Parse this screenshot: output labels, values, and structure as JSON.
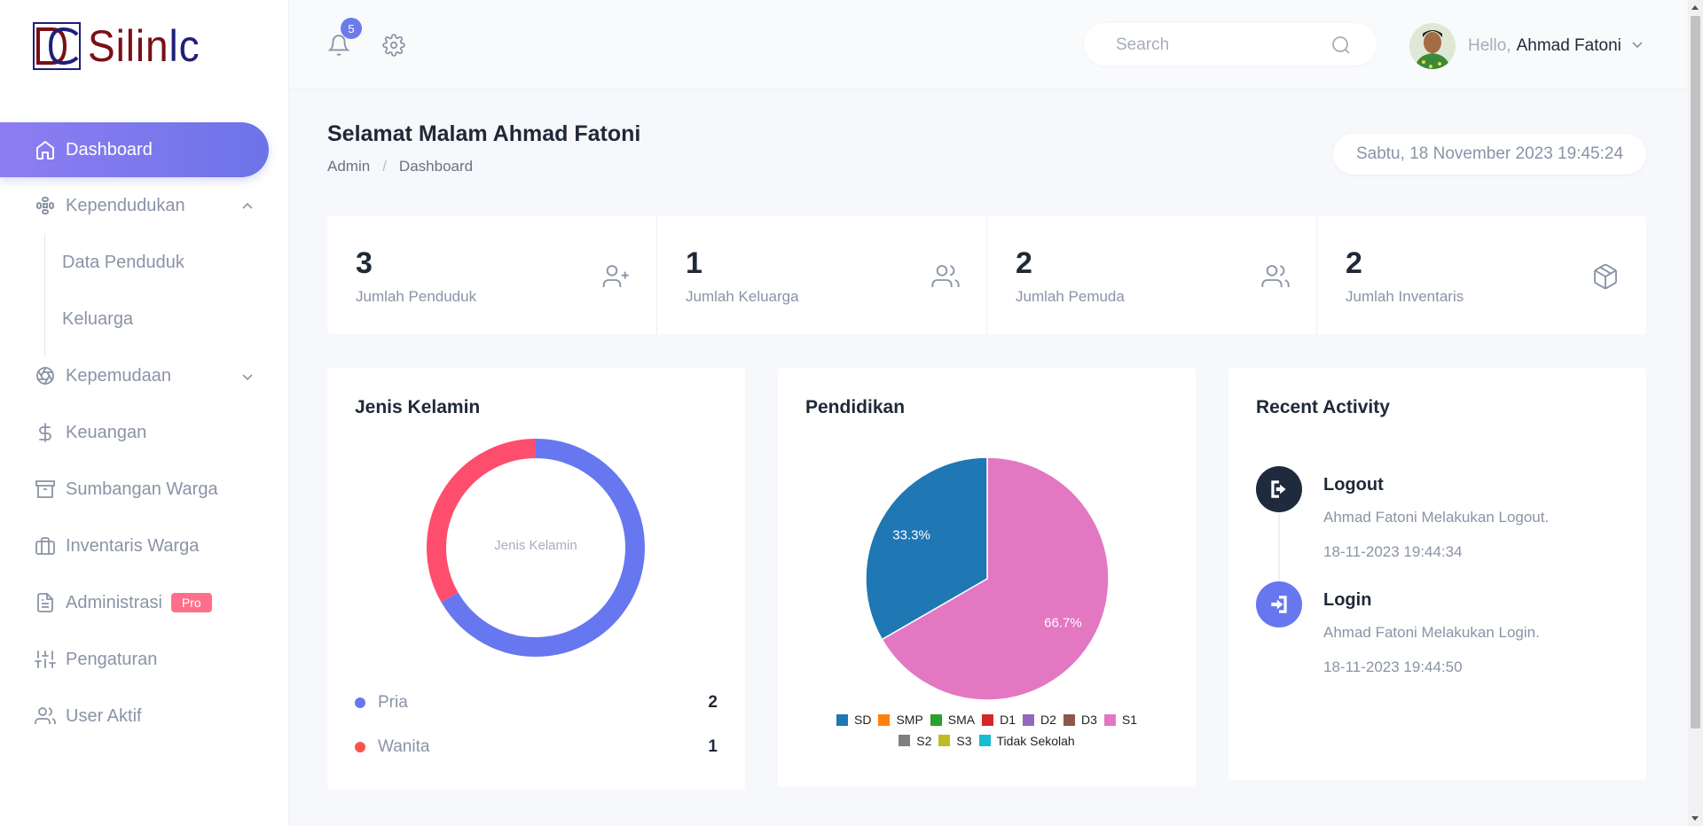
{
  "brand": {
    "logo_text_a": "Silin",
    "logo_text_b": "lc",
    "logo_mark_letters": "DC"
  },
  "sidebar": {
    "items": [
      {
        "label": "Dashboard",
        "icon": "home-icon",
        "active": true
      },
      {
        "label": "Kependudukan",
        "icon": "grid-icon",
        "expanded": true,
        "children": [
          {
            "label": "Data Penduduk"
          },
          {
            "label": "Keluarga"
          }
        ]
      },
      {
        "label": "Kepemudaan",
        "icon": "aperture-icon",
        "expanded": false
      },
      {
        "label": "Keuangan",
        "icon": "dollar-icon"
      },
      {
        "label": "Sumbangan Warga",
        "icon": "archive-icon"
      },
      {
        "label": "Inventaris Warga",
        "icon": "briefcase-icon"
      },
      {
        "label": "Administrasi",
        "icon": "file-text-icon",
        "badge": "Pro"
      },
      {
        "label": "Pengaturan",
        "icon": "sliders-icon"
      },
      {
        "label": "User Aktif",
        "icon": "users-icon"
      }
    ]
  },
  "topbar": {
    "notification_count": "5",
    "search_placeholder": "Search",
    "search_value": "",
    "hello": "Hello,",
    "user_name": "Ahmad Fatoni"
  },
  "page": {
    "title": "Selamat Malam Ahmad Fatoni",
    "breadcrumb": [
      "Admin",
      "Dashboard"
    ],
    "datetime": "Sabtu, 18 November 2023 19:45:24"
  },
  "stats": [
    {
      "value": "3",
      "label": "Jumlah Penduduk",
      "icon": "user-plus-icon"
    },
    {
      "value": "1",
      "label": "Jumlah Keluarga",
      "icon": "users-icon"
    },
    {
      "value": "2",
      "label": "Jumlah Pemuda",
      "icon": "users-icon"
    },
    {
      "value": "2",
      "label": "Jumlah Inventaris",
      "icon": "box-icon"
    }
  ],
  "gender_card": {
    "title": "Jenis Kelamin",
    "center_label": "Jenis Kelamin",
    "legend": [
      {
        "label": "Pria",
        "value": "2",
        "color": "#6777ef"
      },
      {
        "label": "Wanita",
        "value": "1",
        "color": "#fc544b"
      }
    ]
  },
  "education_card": {
    "title": "Pendidikan",
    "slice_labels": [
      "33.3%",
      "66.7%"
    ],
    "legend": [
      {
        "label": "SD",
        "color": "#1f77b4"
      },
      {
        "label": "SMP",
        "color": "#ff7f0e"
      },
      {
        "label": "SMA",
        "color": "#2ca02c"
      },
      {
        "label": "D1",
        "color": "#d62728"
      },
      {
        "label": "D2",
        "color": "#9467bd"
      },
      {
        "label": "D3",
        "color": "#8c564b"
      },
      {
        "label": "S1",
        "color": "#e377c2"
      },
      {
        "label": "S2",
        "color": "#7f7f7f"
      },
      {
        "label": "S3",
        "color": "#bcbd22"
      },
      {
        "label": "Tidak Sekolah",
        "color": "#17becf"
      }
    ]
  },
  "activity_card": {
    "title": "Recent Activity",
    "items": [
      {
        "title": "Logout",
        "desc": "Ahmad Fatoni Melakukan Logout.",
        "time": "18-11-2023 19:44:34",
        "icon": "logout-icon",
        "color": "#1f2a3d"
      },
      {
        "title": "Login",
        "desc": "Ahmad Fatoni Melakukan Login.",
        "time": "18-11-2023 19:44:50",
        "icon": "login-icon",
        "color": "#6777ef"
      }
    ]
  },
  "chart_data": [
    {
      "type": "pie",
      "title": "Jenis Kelamin",
      "categories": [
        "Pria",
        "Wanita"
      ],
      "values": [
        2,
        1
      ],
      "colors": [
        "#6777ef",
        "#ff4d6d"
      ],
      "variant": "donut"
    },
    {
      "type": "pie",
      "title": "Pendidikan",
      "categories": [
        "SD",
        "SMP",
        "SMA",
        "D1",
        "D2",
        "D3",
        "S1",
        "S2",
        "S3",
        "Tidak Sekolah"
      ],
      "values": [
        1,
        0,
        0,
        0,
        0,
        0,
        2,
        0,
        0,
        0
      ],
      "data_labels": [
        "33.3%",
        "66.7%"
      ],
      "legend": "bottom"
    }
  ]
}
